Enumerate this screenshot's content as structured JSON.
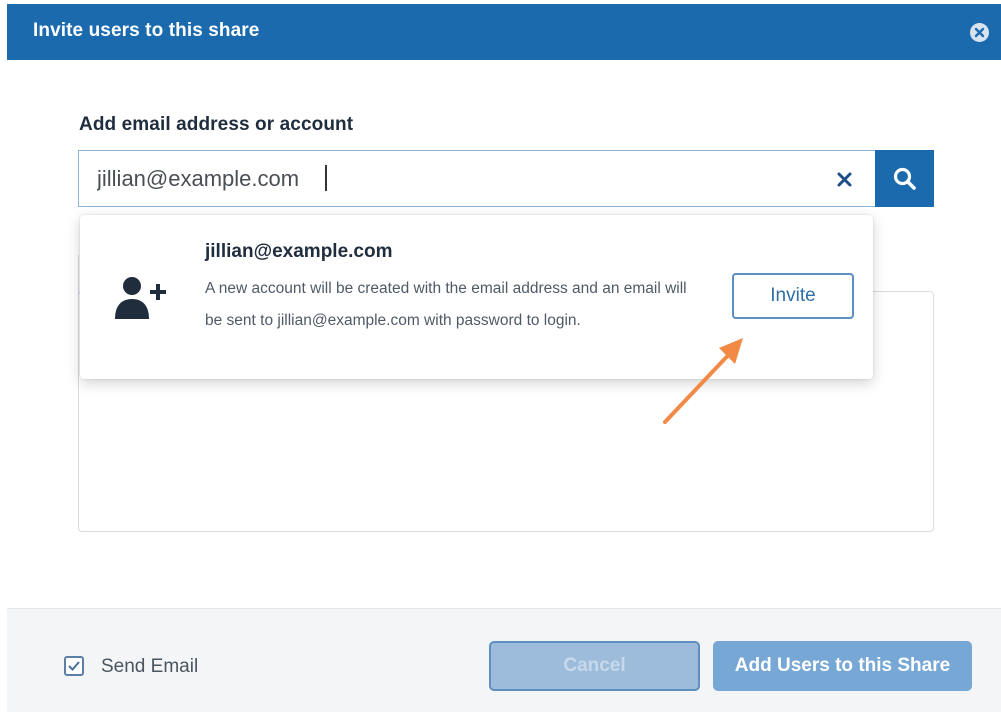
{
  "dialog": {
    "title": "Invite users to this share",
    "close_icon": "close-circle-icon"
  },
  "search": {
    "label": "Add email address or account",
    "value": "jillian@example.com",
    "clear_icon": "clear-x-icon",
    "search_icon": "search-icon"
  },
  "suggestion": {
    "icon": "user-add-icon",
    "email": "jillian@example.com",
    "description": "A new account will be created with the email address and an email will be sent to jillian@example.com with password to login.",
    "invite_label": "Invite"
  },
  "annotation": {
    "arrow_color": "#f28a46"
  },
  "footer": {
    "send_email_label": "Send Email",
    "send_email_checked": true,
    "cancel_label": "Cancel",
    "add_label": "Add Users to this Share"
  },
  "colors": {
    "header_bg": "#1b6aae",
    "primary_disabled": "#76a7d5",
    "cancel_disabled": "#9dbcdb"
  }
}
